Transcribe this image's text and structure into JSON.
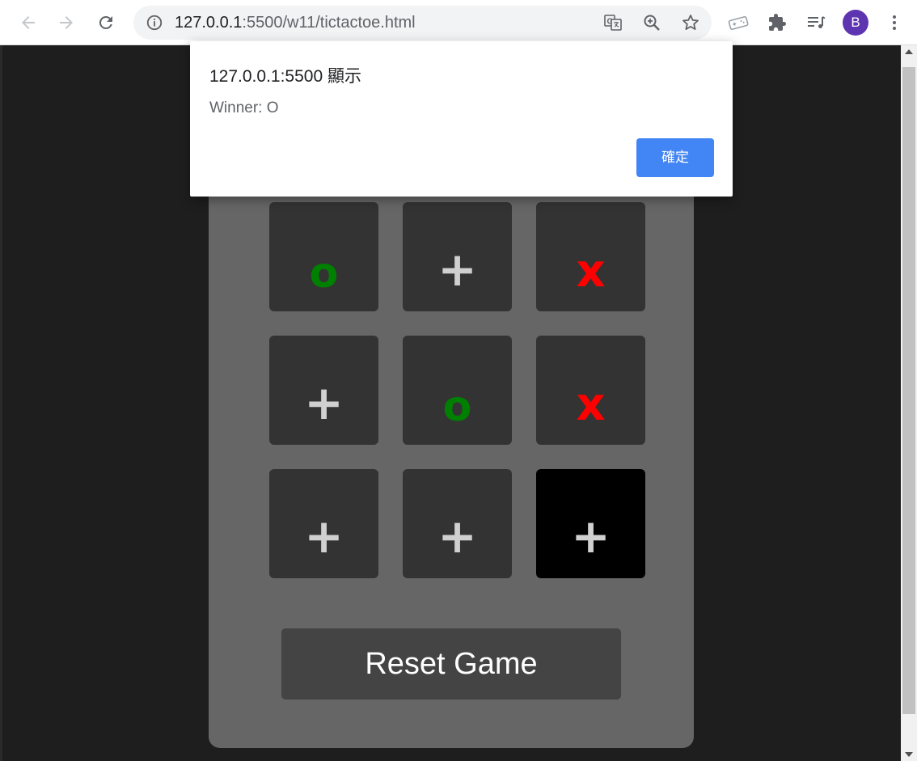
{
  "browser": {
    "url_host": "127.0.0.1",
    "url_rest": ":5500/w11/tictactoe.html",
    "profile_initial": "B",
    "icons": [
      "back-icon",
      "forward-icon",
      "reload-icon",
      "info-icon",
      "translate-icon",
      "zoom-icon",
      "star-icon",
      "game-pad-icon",
      "extensions-icon",
      "reading-list-icon",
      "menu-icon"
    ]
  },
  "game": {
    "cells": [
      "o",
      "+",
      "x",
      "+",
      "o",
      "x",
      "+",
      "+",
      "+"
    ],
    "reset_label": "Reset Game",
    "colors": {
      "o": "#008000",
      "x": "#ff0000",
      "empty": "#d0d0d0",
      "cell_bg": "#333333",
      "active_cell_bg": "#000000",
      "panel_bg": "#666666"
    }
  },
  "dialog": {
    "title": "127.0.0.1:5500 顯示",
    "message": "Winner: O",
    "ok_label": "確定",
    "ok_color": "#4285f4"
  }
}
